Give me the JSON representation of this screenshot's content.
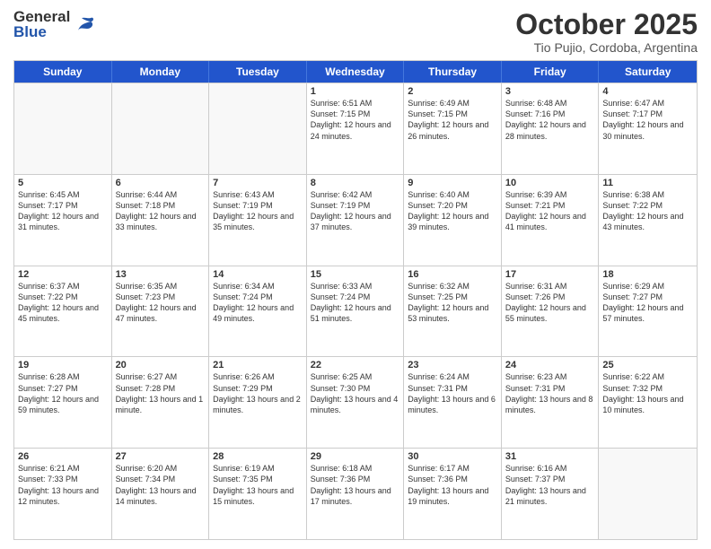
{
  "header": {
    "logo": {
      "general": "General",
      "blue": "Blue"
    },
    "title": "October 2025",
    "location": "Tio Pujio, Cordoba, Argentina"
  },
  "calendar": {
    "days": [
      "Sunday",
      "Monday",
      "Tuesday",
      "Wednesday",
      "Thursday",
      "Friday",
      "Saturday"
    ],
    "rows": [
      [
        {
          "day": "",
          "info": ""
        },
        {
          "day": "",
          "info": ""
        },
        {
          "day": "",
          "info": ""
        },
        {
          "day": "1",
          "info": "Sunrise: 6:51 AM\nSunset: 7:15 PM\nDaylight: 12 hours and 24 minutes."
        },
        {
          "day": "2",
          "info": "Sunrise: 6:49 AM\nSunset: 7:15 PM\nDaylight: 12 hours and 26 minutes."
        },
        {
          "day": "3",
          "info": "Sunrise: 6:48 AM\nSunset: 7:16 PM\nDaylight: 12 hours and 28 minutes."
        },
        {
          "day": "4",
          "info": "Sunrise: 6:47 AM\nSunset: 7:17 PM\nDaylight: 12 hours and 30 minutes."
        }
      ],
      [
        {
          "day": "5",
          "info": "Sunrise: 6:45 AM\nSunset: 7:17 PM\nDaylight: 12 hours and 31 minutes."
        },
        {
          "day": "6",
          "info": "Sunrise: 6:44 AM\nSunset: 7:18 PM\nDaylight: 12 hours and 33 minutes."
        },
        {
          "day": "7",
          "info": "Sunrise: 6:43 AM\nSunset: 7:19 PM\nDaylight: 12 hours and 35 minutes."
        },
        {
          "day": "8",
          "info": "Sunrise: 6:42 AM\nSunset: 7:19 PM\nDaylight: 12 hours and 37 minutes."
        },
        {
          "day": "9",
          "info": "Sunrise: 6:40 AM\nSunset: 7:20 PM\nDaylight: 12 hours and 39 minutes."
        },
        {
          "day": "10",
          "info": "Sunrise: 6:39 AM\nSunset: 7:21 PM\nDaylight: 12 hours and 41 minutes."
        },
        {
          "day": "11",
          "info": "Sunrise: 6:38 AM\nSunset: 7:22 PM\nDaylight: 12 hours and 43 minutes."
        }
      ],
      [
        {
          "day": "12",
          "info": "Sunrise: 6:37 AM\nSunset: 7:22 PM\nDaylight: 12 hours and 45 minutes."
        },
        {
          "day": "13",
          "info": "Sunrise: 6:35 AM\nSunset: 7:23 PM\nDaylight: 12 hours and 47 minutes."
        },
        {
          "day": "14",
          "info": "Sunrise: 6:34 AM\nSunset: 7:24 PM\nDaylight: 12 hours and 49 minutes."
        },
        {
          "day": "15",
          "info": "Sunrise: 6:33 AM\nSunset: 7:24 PM\nDaylight: 12 hours and 51 minutes."
        },
        {
          "day": "16",
          "info": "Sunrise: 6:32 AM\nSunset: 7:25 PM\nDaylight: 12 hours and 53 minutes."
        },
        {
          "day": "17",
          "info": "Sunrise: 6:31 AM\nSunset: 7:26 PM\nDaylight: 12 hours and 55 minutes."
        },
        {
          "day": "18",
          "info": "Sunrise: 6:29 AM\nSunset: 7:27 PM\nDaylight: 12 hours and 57 minutes."
        }
      ],
      [
        {
          "day": "19",
          "info": "Sunrise: 6:28 AM\nSunset: 7:27 PM\nDaylight: 12 hours and 59 minutes."
        },
        {
          "day": "20",
          "info": "Sunrise: 6:27 AM\nSunset: 7:28 PM\nDaylight: 13 hours and 1 minute."
        },
        {
          "day": "21",
          "info": "Sunrise: 6:26 AM\nSunset: 7:29 PM\nDaylight: 13 hours and 2 minutes."
        },
        {
          "day": "22",
          "info": "Sunrise: 6:25 AM\nSunset: 7:30 PM\nDaylight: 13 hours and 4 minutes."
        },
        {
          "day": "23",
          "info": "Sunrise: 6:24 AM\nSunset: 7:31 PM\nDaylight: 13 hours and 6 minutes."
        },
        {
          "day": "24",
          "info": "Sunrise: 6:23 AM\nSunset: 7:31 PM\nDaylight: 13 hours and 8 minutes."
        },
        {
          "day": "25",
          "info": "Sunrise: 6:22 AM\nSunset: 7:32 PM\nDaylight: 13 hours and 10 minutes."
        }
      ],
      [
        {
          "day": "26",
          "info": "Sunrise: 6:21 AM\nSunset: 7:33 PM\nDaylight: 13 hours and 12 minutes."
        },
        {
          "day": "27",
          "info": "Sunrise: 6:20 AM\nSunset: 7:34 PM\nDaylight: 13 hours and 14 minutes."
        },
        {
          "day": "28",
          "info": "Sunrise: 6:19 AM\nSunset: 7:35 PM\nDaylight: 13 hours and 15 minutes."
        },
        {
          "day": "29",
          "info": "Sunrise: 6:18 AM\nSunset: 7:36 PM\nDaylight: 13 hours and 17 minutes."
        },
        {
          "day": "30",
          "info": "Sunrise: 6:17 AM\nSunset: 7:36 PM\nDaylight: 13 hours and 19 minutes."
        },
        {
          "day": "31",
          "info": "Sunrise: 6:16 AM\nSunset: 7:37 PM\nDaylight: 13 hours and 21 minutes."
        },
        {
          "day": "",
          "info": ""
        }
      ]
    ]
  }
}
